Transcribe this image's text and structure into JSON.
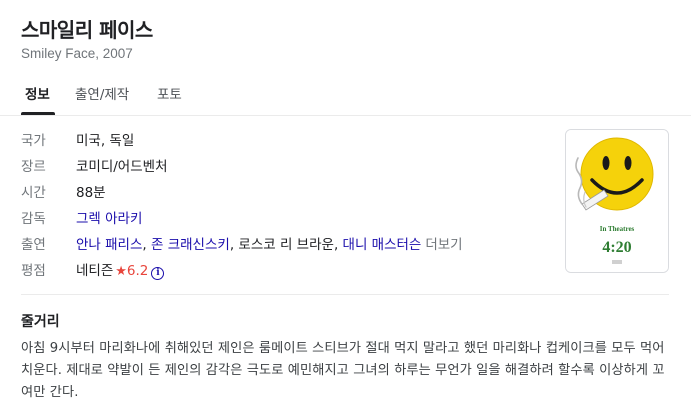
{
  "movie": {
    "title": "스마일리 페이스",
    "subtitle": "Smiley Face, 2007"
  },
  "tabs": [
    {
      "label": "정보",
      "active": true
    },
    {
      "label": "출연/제작",
      "active": false
    },
    {
      "label": "포토",
      "active": false
    }
  ],
  "info": {
    "country": {
      "label": "국가",
      "value": "미국, 독일"
    },
    "genre": {
      "label": "장르",
      "value": "코미디/어드벤처"
    },
    "runtime": {
      "label": "시간",
      "value": "88분"
    },
    "director": {
      "label": "감독",
      "value": "그렉 아라키"
    },
    "cast": {
      "label": "출연",
      "names": [
        "안나 패리스",
        "존 크래신스키",
        "로스코 리 브라운",
        "대니 매스터슨"
      ],
      "separator": ", ",
      "more": "더보기"
    },
    "rating": {
      "label": "평점",
      "source": "네티즌",
      "star": "★",
      "value": "6.2",
      "info_glyph": "i"
    }
  },
  "poster": {
    "tagline_top": "In Theatres",
    "tagline_bottom": "4:20",
    "colors": {
      "face": "#f5d20b",
      "text": "#2e7d32",
      "background": "#ffffff"
    }
  },
  "plot": {
    "heading": "줄거리",
    "text": "아침 9시부터 마리화나에 취해있던 제인은 룸메이트 스티브가 절대 먹지 말라고 했던 마리화나 컵케이크를 모두 먹어치운다. 제대로 약발이 든 제인의 감각은 극도로 예민해지고 그녀의 하루는 무언가 일을 해결하려 할수록 이상하게 꼬여만 간다."
  },
  "colors": {
    "link": "#1a0dab",
    "muted": "#70757a",
    "text": "#202124",
    "rating_red": "#e8453c"
  }
}
